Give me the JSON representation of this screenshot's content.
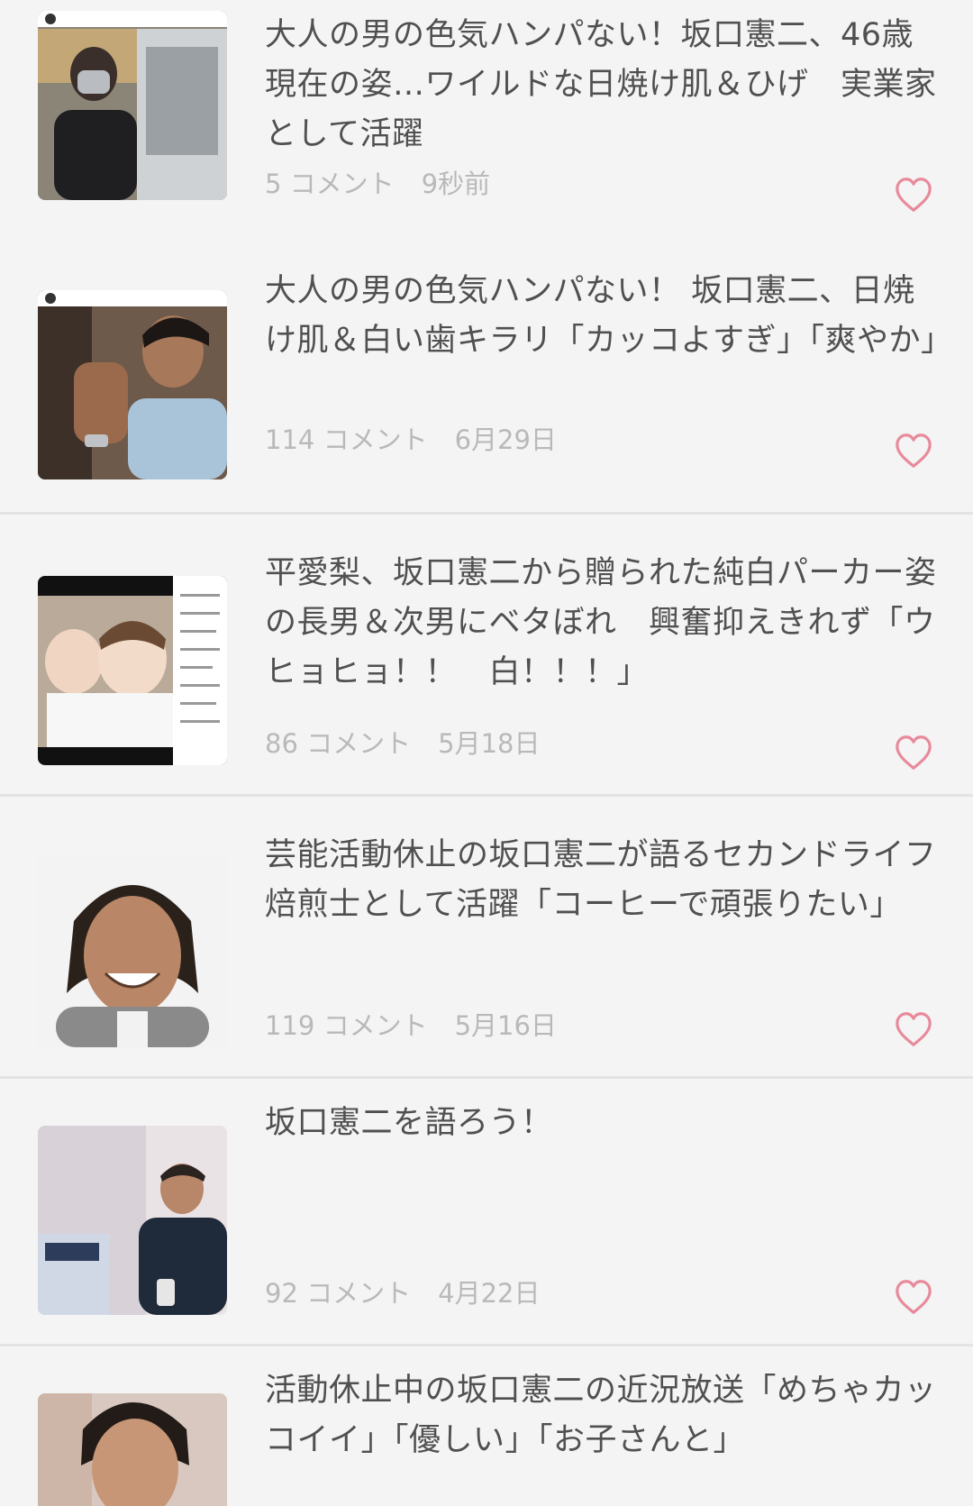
{
  "articles": [
    {
      "title": "大人の男の色気ハンパない！坂口憲二、46歳現在の姿…ワイルドな日焼け肌＆ひげ　実業家として活躍",
      "comments": "5 コメント",
      "time": "9秒前",
      "thumb_icon": "photo-thumbnail-icon",
      "fav_icon": "heart-outline-icon"
    },
    {
      "title": "大人の男の色気ハンパない！ 坂口憲二、日焼け肌＆白い歯キラリ「カッコよすぎ」「爽やか」",
      "comments": "114 コメント",
      "time": "6月29日",
      "thumb_icon": "photo-thumbnail-icon",
      "fav_icon": "heart-outline-icon"
    },
    {
      "title": "平愛梨、坂口憲二から贈られた純白パーカー姿の長男＆次男にベタぼれ　興奮抑えきれず「ウヒョヒョ！！　白！！！」",
      "comments": "86 コメント",
      "time": "5月18日",
      "thumb_icon": "photo-thumbnail-icon",
      "fav_icon": "heart-outline-icon"
    },
    {
      "title": "芸能活動休止の坂口憲二が語るセカンドライフ　焙煎士として活躍「コーヒーで頑張りたい」",
      "comments": "119 コメント",
      "time": "5月16日",
      "thumb_icon": "photo-thumbnail-icon",
      "fav_icon": "heart-outline-icon"
    },
    {
      "title": "坂口憲二を語ろう！",
      "comments": "92 コメント",
      "time": "4月22日",
      "thumb_icon": "photo-thumbnail-icon",
      "fav_icon": "heart-outline-icon"
    },
    {
      "title": "活動休止中の坂口憲二の近況放送「めちゃカッコイイ」「優しい」「お子さんと」",
      "thumb_icon": "photo-thumbnail-icon"
    }
  ],
  "colors": {
    "background": "#f4f4f4",
    "divider": "#e3e3e3",
    "title_text": "#505050",
    "meta_text": "#b9b9b9",
    "heart": "#e88a9b"
  }
}
